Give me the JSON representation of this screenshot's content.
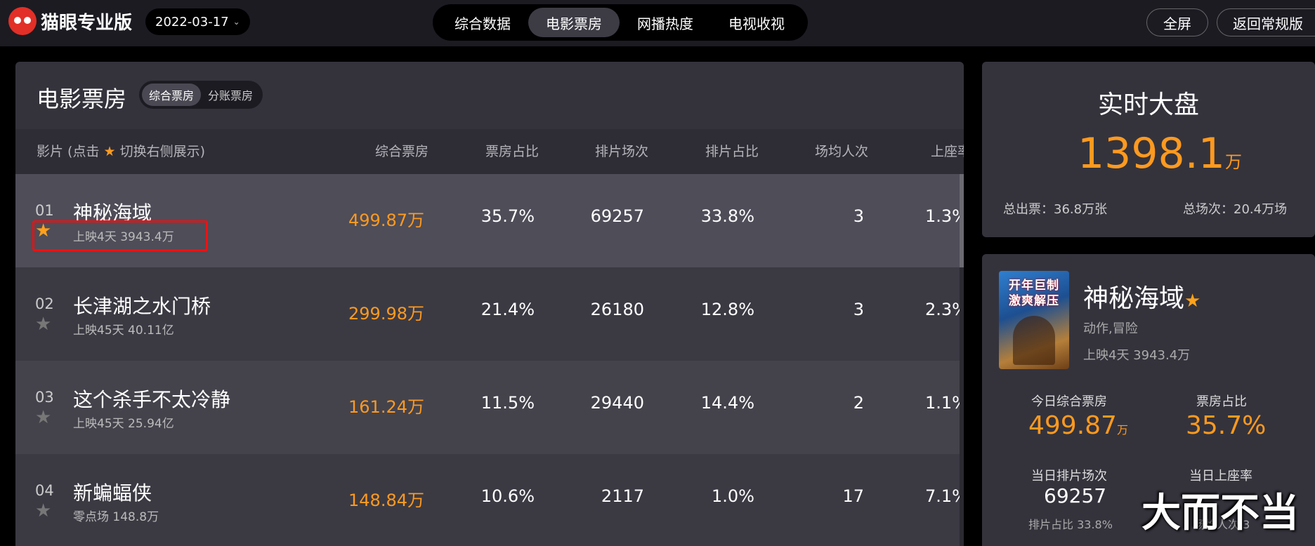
{
  "header": {
    "logo_text": "猫眼专业版",
    "date": "2022-03-17",
    "nav_tabs": [
      "综合数据",
      "电影票房",
      "网播热度",
      "电视收视"
    ],
    "active_tab": "电影票房",
    "fullscreen_label": "全屏",
    "back_label": "返回常规版"
  },
  "panel": {
    "title": "电影票房",
    "toggle": [
      "综合票房",
      "分账票房"
    ],
    "columns": {
      "film_prefix": "影片 (点击",
      "film_suffix": "切换右侧展示)",
      "box": "综合票房",
      "box_share": "票房占比",
      "shows": "排片场次",
      "show_share": "排片占比",
      "avg": "场均人次",
      "rate": "上座率"
    },
    "rows": [
      {
        "rank": "01",
        "name": "神秘海域",
        "sub": "上映4天  3943.4万",
        "box": "499.87万",
        "box_share": "35.7%",
        "shows": "69257",
        "show_share": "33.8%",
        "avg": "3",
        "rate": "1.3%",
        "starred": true
      },
      {
        "rank": "02",
        "name": "长津湖之水门桥",
        "sub": "上映45天  40.11亿",
        "box": "299.98万",
        "box_share": "21.4%",
        "shows": "26180",
        "show_share": "12.8%",
        "avg": "3",
        "rate": "2.3%",
        "starred": false
      },
      {
        "rank": "03",
        "name": "这个杀手不太冷静",
        "sub": "上映45天  25.94亿",
        "box": "161.24万",
        "box_share": "11.5%",
        "shows": "29440",
        "show_share": "14.4%",
        "avg": "2",
        "rate": "1.1%",
        "starred": false
      },
      {
        "rank": "04",
        "name": "新蝙蝠侠",
        "sub": "零点场  148.8万",
        "box": "148.84万",
        "box_share": "10.6%",
        "shows": "2117",
        "show_share": "1.0%",
        "avg": "17",
        "rate": "7.1%",
        "starred": false
      }
    ]
  },
  "realtime": {
    "title": "实时大盘",
    "total": "1398.1",
    "unit": "万",
    "tickets": "总出票：36.8万张",
    "shows": "总场次：20.4万场"
  },
  "detail": {
    "poster_line1": "开年巨制",
    "poster_line2": "激爽解压",
    "name": "神秘海域",
    "genre": "动作,冒险",
    "release": "上映4天  3943.4万",
    "box_label": "今日综合票房",
    "box_value": "499.87",
    "box_unit": "万",
    "share_label": "票房占比",
    "share_value": "35.7%",
    "shows_label": "当日排片场次",
    "shows_value": "69257",
    "show_share": "排片占比 33.8%",
    "rate_label": "当日上座率",
    "avg_label": "场均人次 3"
  },
  "watermark": "大而不当",
  "colors": {
    "accent_orange": "#ff9a1f",
    "star_gold": "#ffa21b",
    "highlight_red": "#ee1111"
  }
}
